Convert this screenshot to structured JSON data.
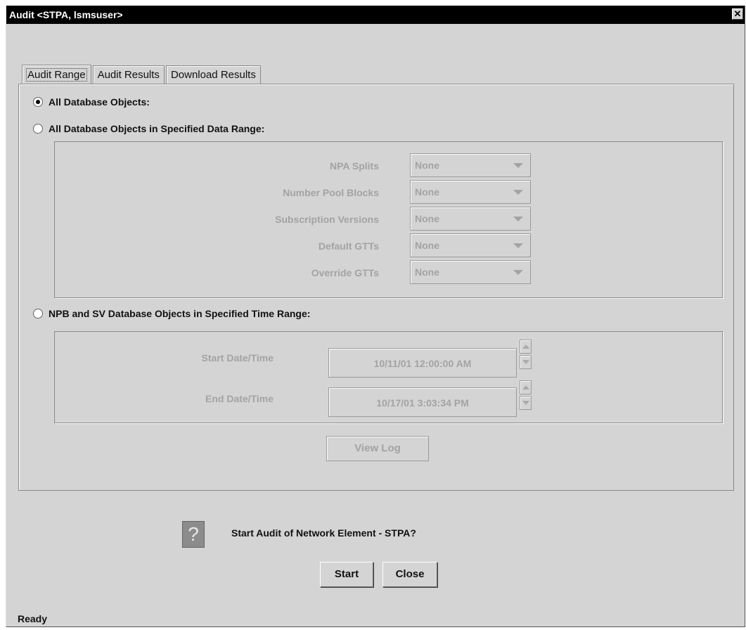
{
  "window": {
    "title": "Audit <STPA, lsmsuser>",
    "close_glyph": "✕"
  },
  "tabs": [
    {
      "label": "Audit Range",
      "active": true
    },
    {
      "label": "Audit Results",
      "active": false
    },
    {
      "label": "Download Results",
      "active": false
    }
  ],
  "options": {
    "all": {
      "label": "All Database Objects:",
      "checked": true
    },
    "data_range": {
      "label": "All Database Objects in Specified Data Range:",
      "checked": false
    },
    "time_range": {
      "label": "NPB and SV Database Objects in Specified Time Range:",
      "checked": false
    }
  },
  "data_range_fields": [
    {
      "label": "NPA Splits",
      "value": "None"
    },
    {
      "label": "Number Pool Blocks",
      "value": "None"
    },
    {
      "label": "Subscription Versions",
      "value": "None"
    },
    {
      "label": "Default GTTs",
      "value": "None"
    },
    {
      "label": "Override GTTs",
      "value": "None"
    }
  ],
  "time_range_fields": {
    "start": {
      "label": "Start Date/Time",
      "value": "10/11/01 12:00:00 AM"
    },
    "end": {
      "label": "End Date/Time",
      "value": "10/17/01 3:03:34 PM"
    }
  },
  "buttons": {
    "view_log": "View Log",
    "start": "Start",
    "close": "Close"
  },
  "prompt": {
    "icon": "question-icon",
    "glyph": "?",
    "text": "Start Audit of Network Element - STPA?"
  },
  "status": "Ready"
}
